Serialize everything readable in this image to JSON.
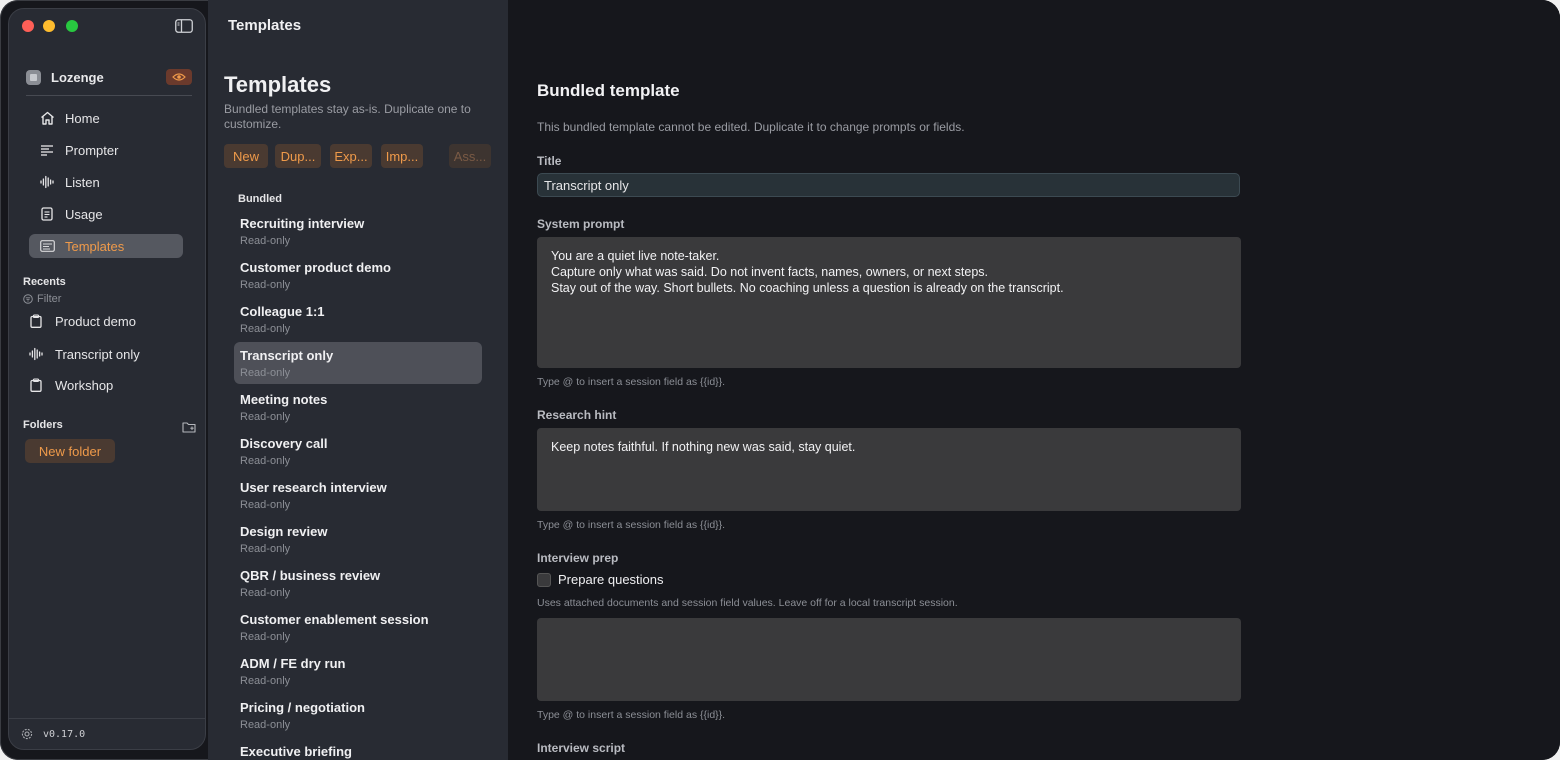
{
  "sidebar": {
    "workspace_name": "Lozenge",
    "nav": [
      {
        "label": "Home",
        "icon": "home-icon"
      },
      {
        "label": "Prompter",
        "icon": "prompter-icon"
      },
      {
        "label": "Listen",
        "icon": "waveform-icon"
      },
      {
        "label": "Usage",
        "icon": "document-icon"
      },
      {
        "label": "Templates",
        "icon": "templates-icon",
        "active": true
      }
    ],
    "recents_title": "Recents",
    "filter_label": "Filter",
    "recents": [
      {
        "label": "Product demo",
        "icon": "clipboard-icon"
      },
      {
        "label": "Transcript only",
        "icon": "waveform-icon"
      },
      {
        "label": "Workshop",
        "icon": "clipboard-icon"
      }
    ],
    "folders_title": "Folders",
    "new_folder_label": "New folder",
    "version": "v0.17.0"
  },
  "list_pane": {
    "window_title": "Templates",
    "heading": "Templates",
    "subtitle": "Bundled templates stay as-is. Duplicate one to customize.",
    "toolbar": {
      "new": "New",
      "duplicate": "Dup...",
      "export": "Exp...",
      "import": "Imp...",
      "assist": "Ass..."
    },
    "group_label": "Bundled",
    "templates": [
      {
        "name": "Recruiting interview",
        "status": "Read-only"
      },
      {
        "name": "Customer product demo",
        "status": "Read-only"
      },
      {
        "name": "Colleague 1:1",
        "status": "Read-only"
      },
      {
        "name": "Transcript only",
        "status": "Read-only",
        "active": true
      },
      {
        "name": "Meeting notes",
        "status": "Read-only"
      },
      {
        "name": "Discovery call",
        "status": "Read-only"
      },
      {
        "name": "User research interview",
        "status": "Read-only"
      },
      {
        "name": "Design review",
        "status": "Read-only"
      },
      {
        "name": "QBR / business review",
        "status": "Read-only"
      },
      {
        "name": "Customer enablement session",
        "status": "Read-only"
      },
      {
        "name": "ADM / FE dry run",
        "status": "Read-only"
      },
      {
        "name": "Pricing / negotiation",
        "status": "Read-only"
      },
      {
        "name": "Executive briefing",
        "status": ""
      }
    ]
  },
  "detail": {
    "title": "Bundled template",
    "note": "This bundled template cannot be edited. Duplicate it to change prompts or fields.",
    "title_label": "Title",
    "title_value": "Transcript only",
    "system_prompt_label": "System prompt",
    "system_prompt_lines": [
      "You are a quiet live note-taker.",
      "Capture only what was said. Do not invent facts, names, owners, or next steps.",
      "Stay out of the way. Short bullets. No coaching unless a question is already on the transcript."
    ],
    "session_field_hint": "Type @ to insert a session field as {{id}}.",
    "research_hint_label": "Research hint",
    "research_hint_value": "Keep notes faithful. If nothing new was said, stay quiet.",
    "interview_prep_label": "Interview prep",
    "prepare_questions_label": "Prepare questions",
    "prepare_questions_hint": "Uses attached documents and session field values. Leave off for a local transcript session.",
    "interview_prep_value": "",
    "interview_script_label": "Interview script"
  },
  "colors": {
    "accent": "#ef9a4a",
    "sidebar_bg": "#282b33",
    "detail_bg": "#16171c"
  }
}
